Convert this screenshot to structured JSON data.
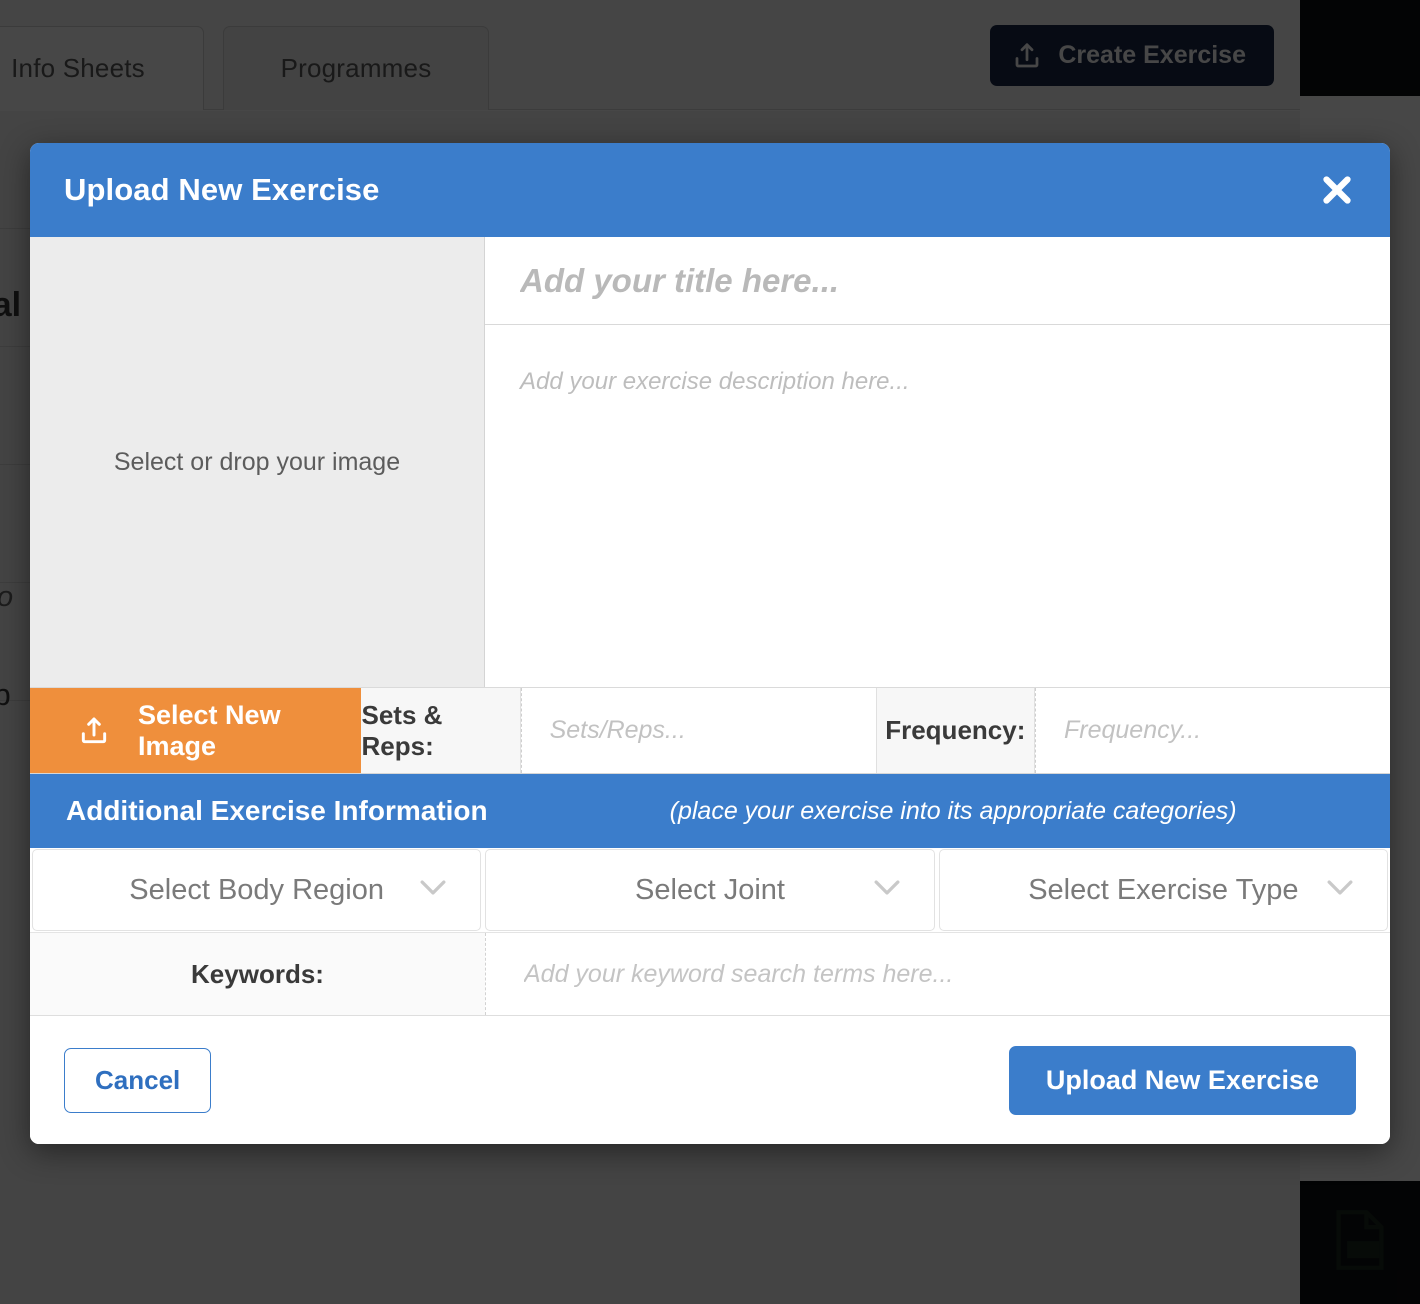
{
  "background": {
    "tabs": [
      {
        "label": "Info Sheets",
        "active": true
      },
      {
        "label": "Programmes",
        "active": false
      }
    ],
    "create_button": {
      "label": "Create Exercise",
      "icon": "upload-icon",
      "color": "#1b2a4a"
    },
    "heading_fragment": "nal",
    "text_fragment_a": "wo",
    "text_fragment_b": "l b",
    "pdf_icon_label": "PDF"
  },
  "modal": {
    "title": "Upload New Exercise",
    "header_color": "#3b7dcb",
    "close_icon": "close-icon",
    "dropzone": {
      "label": "Select or drop your image"
    },
    "title_field": {
      "value": "",
      "placeholder": "Add your title here..."
    },
    "description_field": {
      "value": "",
      "placeholder": "Add your exercise description here..."
    },
    "select_image_button": {
      "label": "Select New Image",
      "icon": "upload-icon",
      "color": "#ef8f3c"
    },
    "sets_reps": {
      "label": "Sets & Reps:",
      "value": "",
      "placeholder": "Sets/Reps..."
    },
    "frequency": {
      "label": "Frequency:",
      "value": "",
      "placeholder": "Frequency..."
    },
    "section": {
      "title": "Additional Exercise Information",
      "hint": "(place your exercise into its appropriate categories)"
    },
    "selects": [
      {
        "label": "Select Body Region",
        "icon": "chevron-down-icon"
      },
      {
        "label": "Select Joint",
        "icon": "chevron-down-icon"
      },
      {
        "label": "Select Exercise Type",
        "icon": "chevron-down-icon"
      }
    ],
    "keywords": {
      "label": "Keywords:",
      "value": "",
      "placeholder": "Add your keyword search terms here..."
    },
    "footer": {
      "cancel_label": "Cancel",
      "submit_label": "Upload New Exercise"
    }
  }
}
